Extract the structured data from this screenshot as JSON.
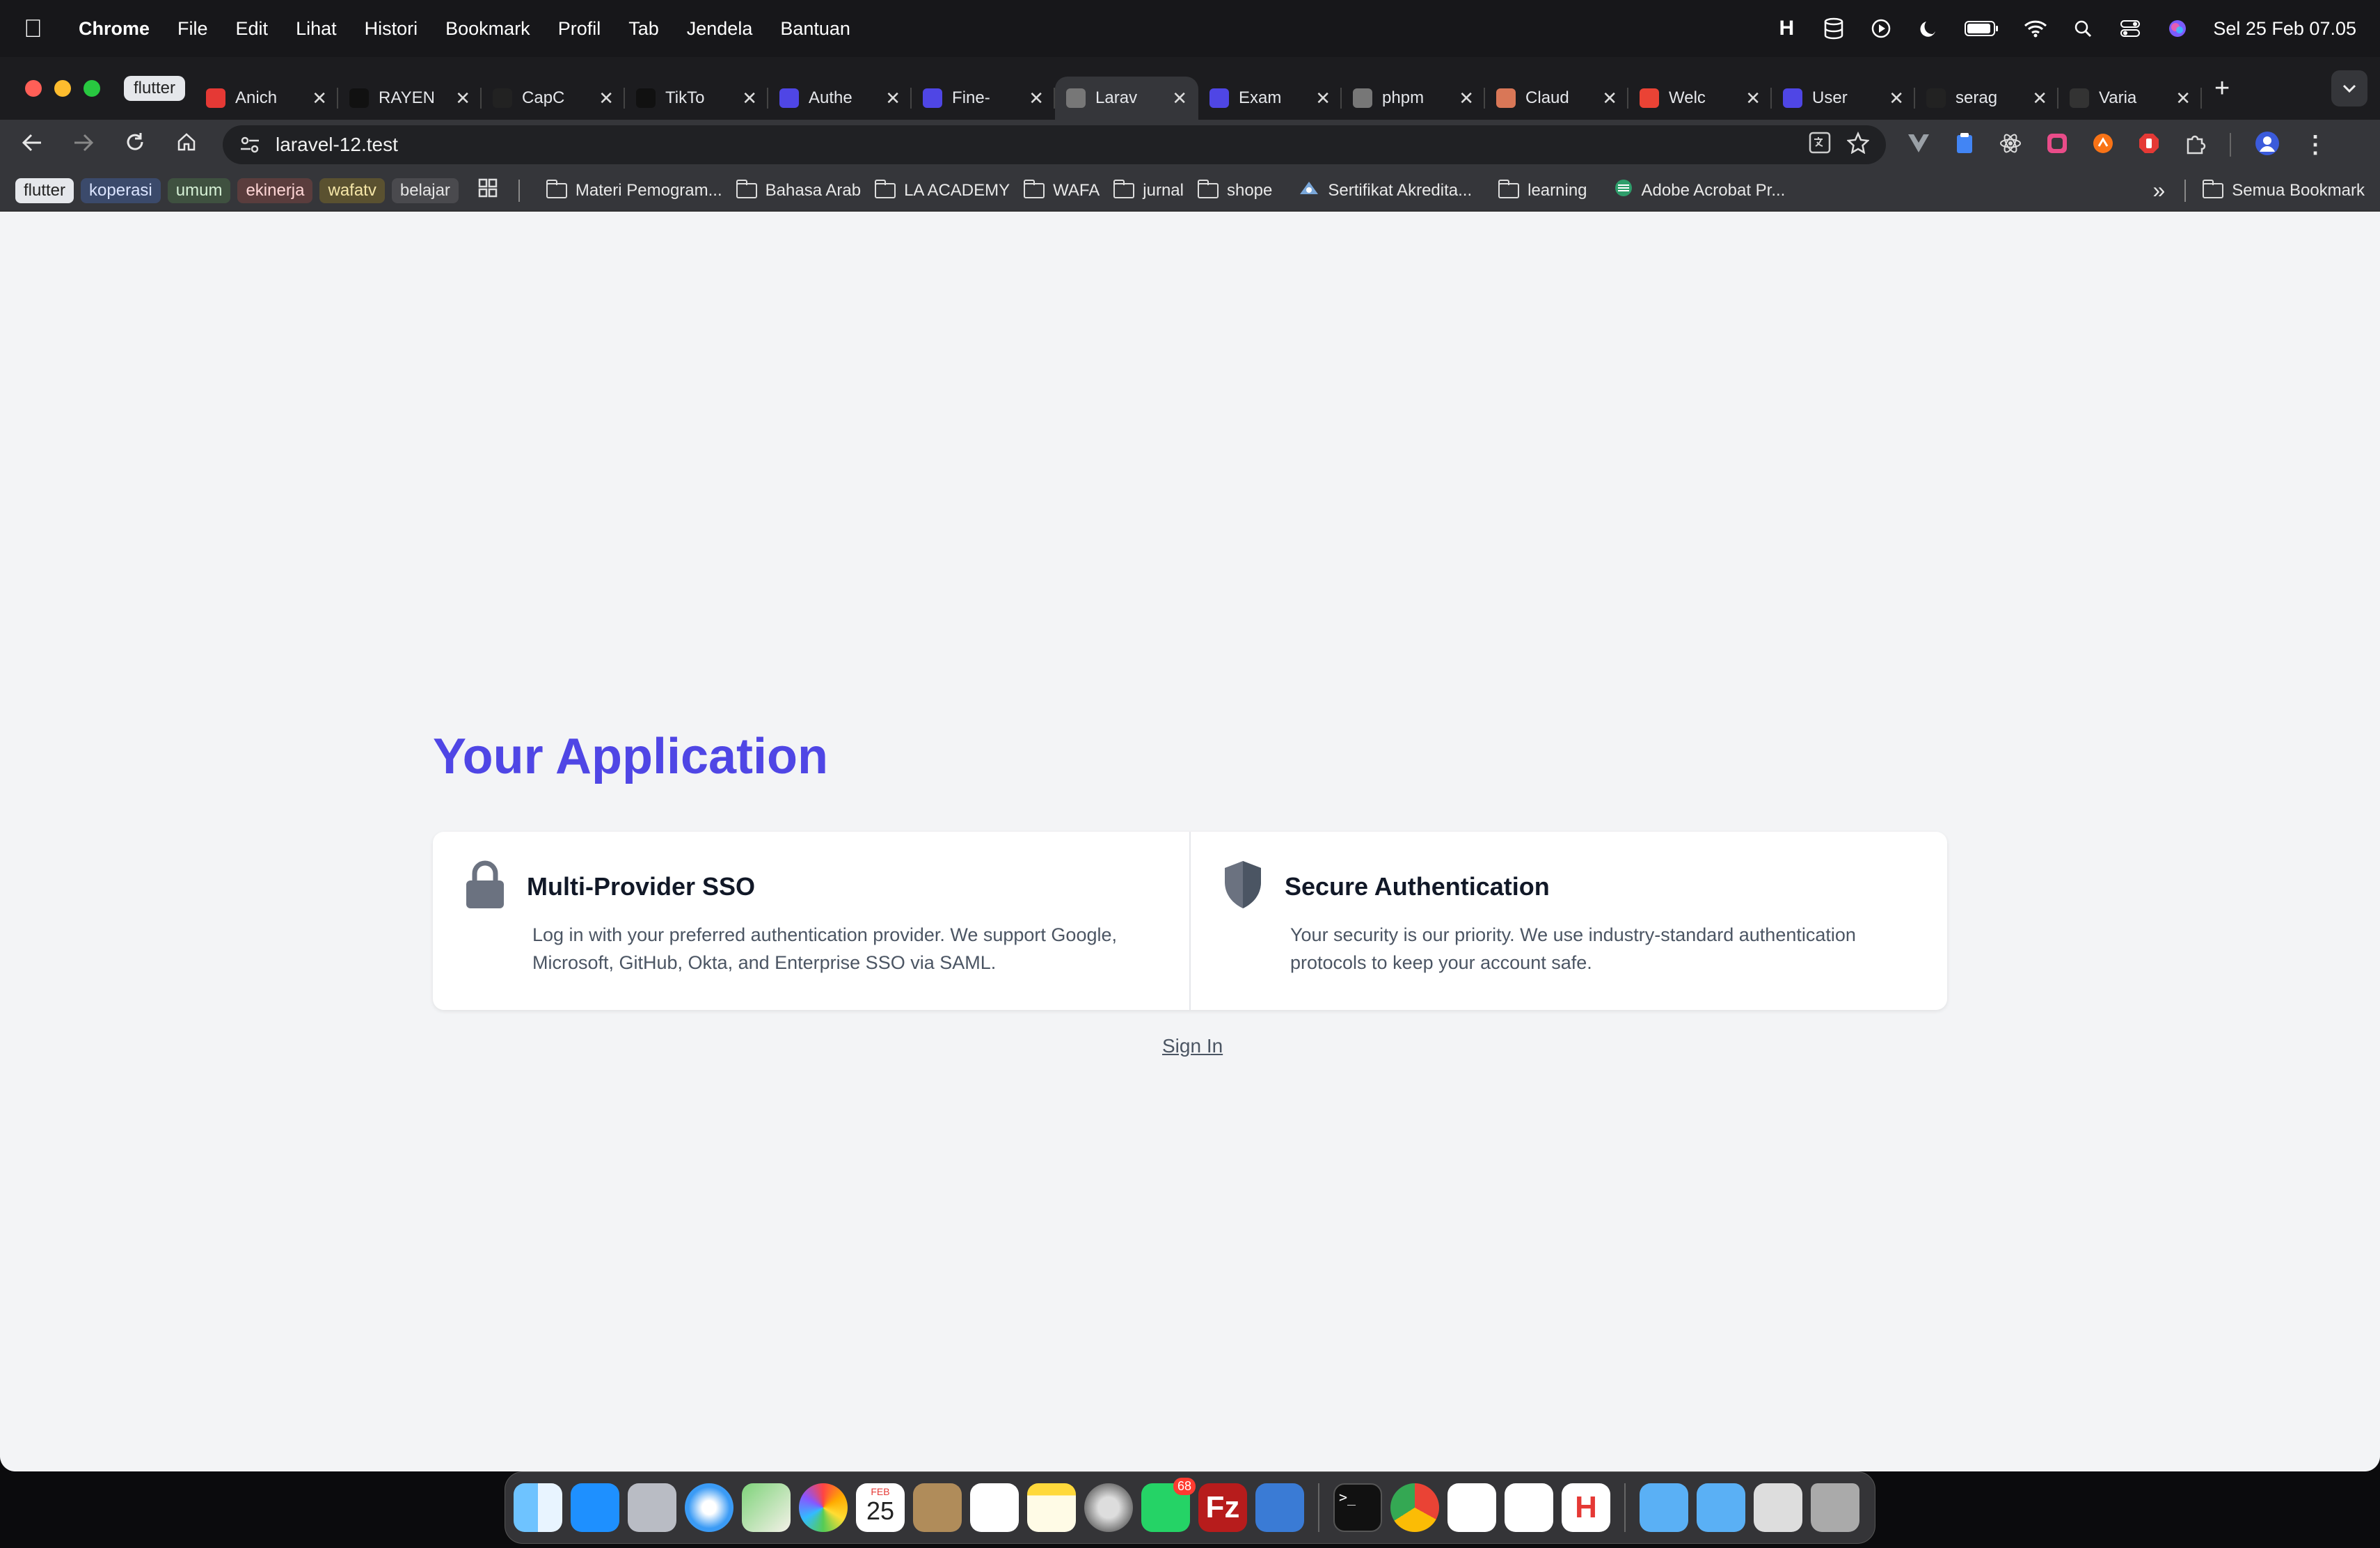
{
  "menubar": {
    "app_name": "Chrome",
    "menus": [
      "File",
      "Edit",
      "Lihat",
      "Histori",
      "Bookmark",
      "Profil",
      "Tab",
      "Jendela",
      "Bantuan"
    ],
    "clock": "Sel 25 Feb  07.05"
  },
  "tabs": {
    "group_label": "flutter",
    "items": [
      {
        "title": "Anich",
        "icon": "anime-icon",
        "color": "#e53935"
      },
      {
        "title": "RAYEN",
        "icon": "tiktok-icon",
        "color": "#111111"
      },
      {
        "title": "CapC",
        "icon": "capcut-icon",
        "color": "#222222"
      },
      {
        "title": "TikTo",
        "icon": "tiktok-icon",
        "color": "#111111"
      },
      {
        "title": "Authe",
        "icon": "auth-icon",
        "color": "#4f46e5"
      },
      {
        "title": "Fine-",
        "icon": "auth-icon",
        "color": "#4f46e5"
      },
      {
        "title": "Larav",
        "icon": "globe-icon",
        "color": "#777777",
        "active": true
      },
      {
        "title": "Exam",
        "icon": "auth-icon",
        "color": "#4f46e5"
      },
      {
        "title": "phpm",
        "icon": "globe-icon",
        "color": "#777777"
      },
      {
        "title": "Claud",
        "icon": "claude-icon",
        "color": "#d97757"
      },
      {
        "title": "Welc",
        "icon": "gmail-icon",
        "color": "#ea4335"
      },
      {
        "title": "User",
        "icon": "auth-icon",
        "color": "#4f46e5"
      },
      {
        "title": "serag",
        "icon": "github-icon",
        "color": "#222222"
      },
      {
        "title": "Varia",
        "icon": "openai-icon",
        "color": "#333333"
      }
    ]
  },
  "toolbar": {
    "url": "laravel-12.test"
  },
  "bookmarks": {
    "groups": [
      {
        "label": "flutter",
        "bg": "#e5e7eb",
        "fg": "#222222"
      },
      {
        "label": "koperasi",
        "bg": "#3b4a6b",
        "fg": "#dbe4ff"
      },
      {
        "label": "umum",
        "bg": "#3f5140",
        "fg": "#d5f0d5"
      },
      {
        "label": "ekinerja",
        "bg": "#5a3d3d",
        "fg": "#ffd6d6"
      },
      {
        "label": "wafatv",
        "bg": "#5a5130",
        "fg": "#f5e6a8"
      },
      {
        "label": "belajar",
        "bg": "#4a4a4e",
        "fg": "#e5e5e5"
      }
    ],
    "folders": [
      "Materi Pemogram...",
      "Bahasa Arab",
      "LA ACADEMY",
      "WAFA",
      "jurnal",
      "shope"
    ],
    "link_sertifikat": "Sertifikat Akredita...",
    "folder_learning": "learning",
    "link_adobe": "Adobe Acrobat Pr...",
    "all_bookmarks": "Semua Bookmark"
  },
  "page": {
    "title": "Your Application",
    "features": [
      {
        "title": "Multi-Provider SSO",
        "description": "Log in with your preferred authentication provider. We support Google, Microsoft, GitHub, Okta, and Enterprise SSO via SAML.",
        "icon": "lock-icon"
      },
      {
        "title": "Secure Authentication",
        "description": "Your security is our priority. We use industry-standard authentication protocols to keep your account safe.",
        "icon": "shield-icon"
      }
    ],
    "signin_label": "Sign In"
  },
  "dock": {
    "whatsapp_badge": "68",
    "calendar_month": "FEB",
    "calendar_day": "25"
  },
  "colors": {
    "accent": "#4f46e5",
    "page_bg": "#f3f4f6",
    "icon_gray": "#6b7280"
  }
}
